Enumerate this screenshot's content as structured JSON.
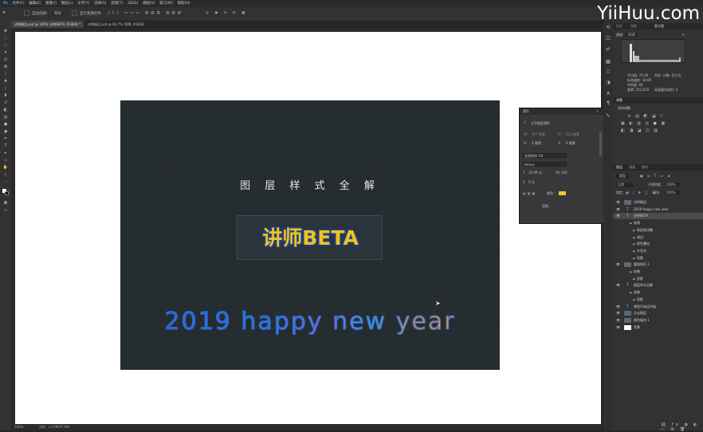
{
  "menu": [
    "文件(F)",
    "编辑(E)",
    "图像(I)",
    "图层(L)",
    "文字(Y)",
    "选择(S)",
    "滤镜(T)",
    "3D(D)",
    "视图(V)",
    "窗口(W)",
    "帮助(H)"
  ],
  "options": {
    "auto_select_label": "自动选择：",
    "auto_select_value": "图层",
    "transform_label": "显示变换控件"
  },
  "tabs": [
    {
      "label": "讲师精品.psd @ 100% (讲师BETA, RGB/8) *"
    },
    {
      "label": "讲师精品.psd @ 66.7% (背景, RGB/8)"
    }
  ],
  "artwork": {
    "title": "图 层 样 式 全 解",
    "box_text": "讲师BETA",
    "year_text": "2019 happy new  year"
  },
  "status": {
    "zoom": "100%",
    "doc": "文档：1.37M/37.0M"
  },
  "properties": {
    "header": "属性",
    "subtitle": "文字图层属性",
    "w_label": "W:",
    "w_value": "407 像素",
    "h_label": "H:",
    "h_value": "422 像素",
    "x_label": "X:",
    "x_value": "4 像素",
    "y_label": "Y:",
    "y_value": "0 像素",
    "font": "思源黑体 CN",
    "weight": "Heavy",
    "size": "35.99 点",
    "tracking": "100",
    "leading": "0 点",
    "color_label": "颜色：",
    "color": "#f1c232",
    "more_label": "段落..."
  },
  "dock": {
    "hist_tabs": [
      "历史",
      "导航",
      "直方图"
    ],
    "channel_label": "通道:",
    "channel_value": "RGB",
    "hist_stats": [
      "平均值: 76.08",
      "标准偏差: 34.69",
      "中间值: 66",
      "像素: 252,620",
      "色阶: 计数: 百分位:",
      "高速缓存级别: 4"
    ],
    "adj_tabs": [
      "调整"
    ],
    "adj_title": "添加调整",
    "layer_tabs": [
      "图层",
      "通道",
      "路径"
    ],
    "kind_label": "类型",
    "blend": "正常",
    "opacity_label": "不透明度:",
    "opacity": "100%",
    "lock_label": "锁定:",
    "fill_label": "填充:",
    "fill": "100%",
    "layers": [
      {
        "name": "讲师精品",
        "type": "thumb",
        "indent": 0
      },
      {
        "name": "2019 happy new year",
        "type": "T",
        "indent": 0
      },
      {
        "name": "讲师BETA",
        "type": "T",
        "indent": 0,
        "selected": true
      },
      {
        "name": "效果",
        "type": "sub",
        "indent": 1
      },
      {
        "name": "斜面和浮雕",
        "type": "sub",
        "indent": 2
      },
      {
        "name": "描边",
        "type": "sub",
        "indent": 2
      },
      {
        "name": "颜色叠加",
        "type": "sub",
        "indent": 2
      },
      {
        "name": "外发光",
        "type": "sub",
        "indent": 2
      },
      {
        "name": "投影",
        "type": "sub",
        "indent": 2
      },
      {
        "name": "圆角矩形 1",
        "type": "thumb",
        "indent": 0
      },
      {
        "name": "效果",
        "type": "sub",
        "indent": 1
      },
      {
        "name": "投影",
        "type": "sub",
        "indent": 2
      },
      {
        "name": "图层样式全解",
        "type": "T",
        "indent": 0
      },
      {
        "name": "效果",
        "type": "sub",
        "indent": 1
      },
      {
        "name": "投影",
        "type": "sub",
        "indent": 2
      },
      {
        "name": "课程开始运作链",
        "type": "T",
        "indent": 0
      },
      {
        "name": "点云图层",
        "type": "thumb",
        "indent": 0
      },
      {
        "name": "颜色填充 1",
        "type": "thumb",
        "indent": 0
      },
      {
        "name": "背景",
        "type": "white",
        "indent": 0
      }
    ]
  },
  "watermark": "YiiHuu.com"
}
